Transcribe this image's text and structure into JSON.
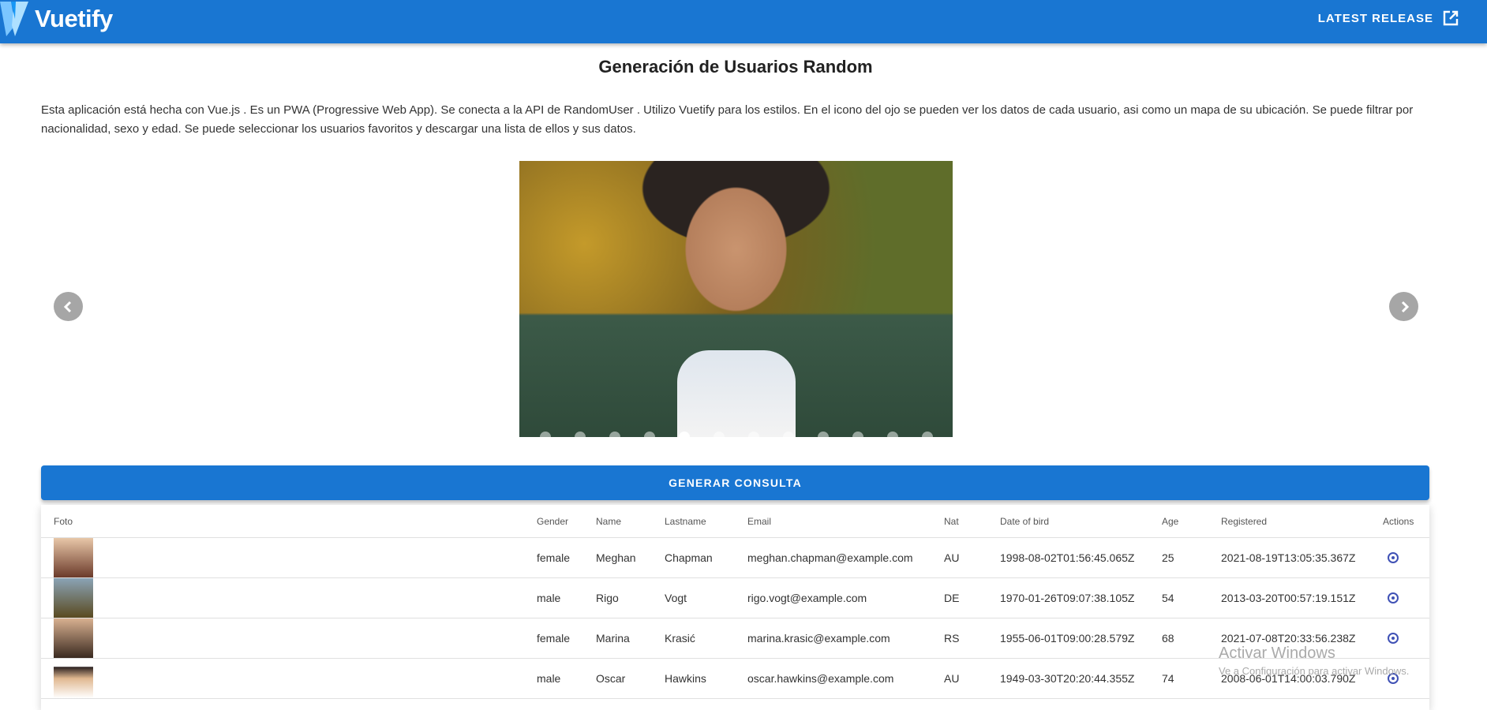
{
  "appbar": {
    "brand": "Vuetify",
    "release_label": "LATEST RELEASE"
  },
  "title": "Generación de Usuarios Random",
  "description": "Esta aplicación está hecha con Vue.js . Es un PWA (Progressive Web App). Se conecta a la API de RandomUser . Utilizo Vuetify para los estilos. En el icono del ojo se pueden ver los datos de cada usuario, asi como un mapa de su ubicación. Se puede filtrar por nacionalidad, sexo y edad. Se puede seleccionar los usuarios favoritos y descargar una lista de ellos y sus datos.",
  "carousel": {
    "slide_count": 12,
    "active_index": 4
  },
  "button": "GENERAR CONSULTA",
  "table": {
    "headers": [
      "Foto",
      "Gender",
      "Name",
      "Lastname",
      "Email",
      "Nat",
      "Date of bird",
      "Age",
      "Registered",
      "Actions"
    ],
    "rows": [
      {
        "gender": "female",
        "name": "Meghan",
        "lastname": "Chapman",
        "email": "meghan.chapman@example.com",
        "nat": "AU",
        "dob": "1998-08-02T01:56:45.065Z",
        "age": "25",
        "registered": "2021-08-19T13:05:35.367Z"
      },
      {
        "gender": "male",
        "name": "Rigo",
        "lastname": "Vogt",
        "email": "rigo.vogt@example.com",
        "nat": "DE",
        "dob": "1970-01-26T09:07:38.105Z",
        "age": "54",
        "registered": "2013-03-20T00:57:19.151Z"
      },
      {
        "gender": "female",
        "name": "Marina",
        "lastname": "Krasić",
        "email": "marina.krasic@example.com",
        "nat": "RS",
        "dob": "1955-06-01T09:00:28.579Z",
        "age": "68",
        "registered": "2021-07-08T20:33:56.238Z"
      },
      {
        "gender": "male",
        "name": "Oscar",
        "lastname": "Hawkins",
        "email": "oscar.hawkins@example.com",
        "nat": "AU",
        "dob": "1949-03-30T20:20:44.355Z",
        "age": "74",
        "registered": "2008-06-01T14:00:03.790Z"
      }
    ]
  },
  "watermark": {
    "line1": "Activar Windows",
    "line2": "Ve a Configuración para activar Windows."
  }
}
